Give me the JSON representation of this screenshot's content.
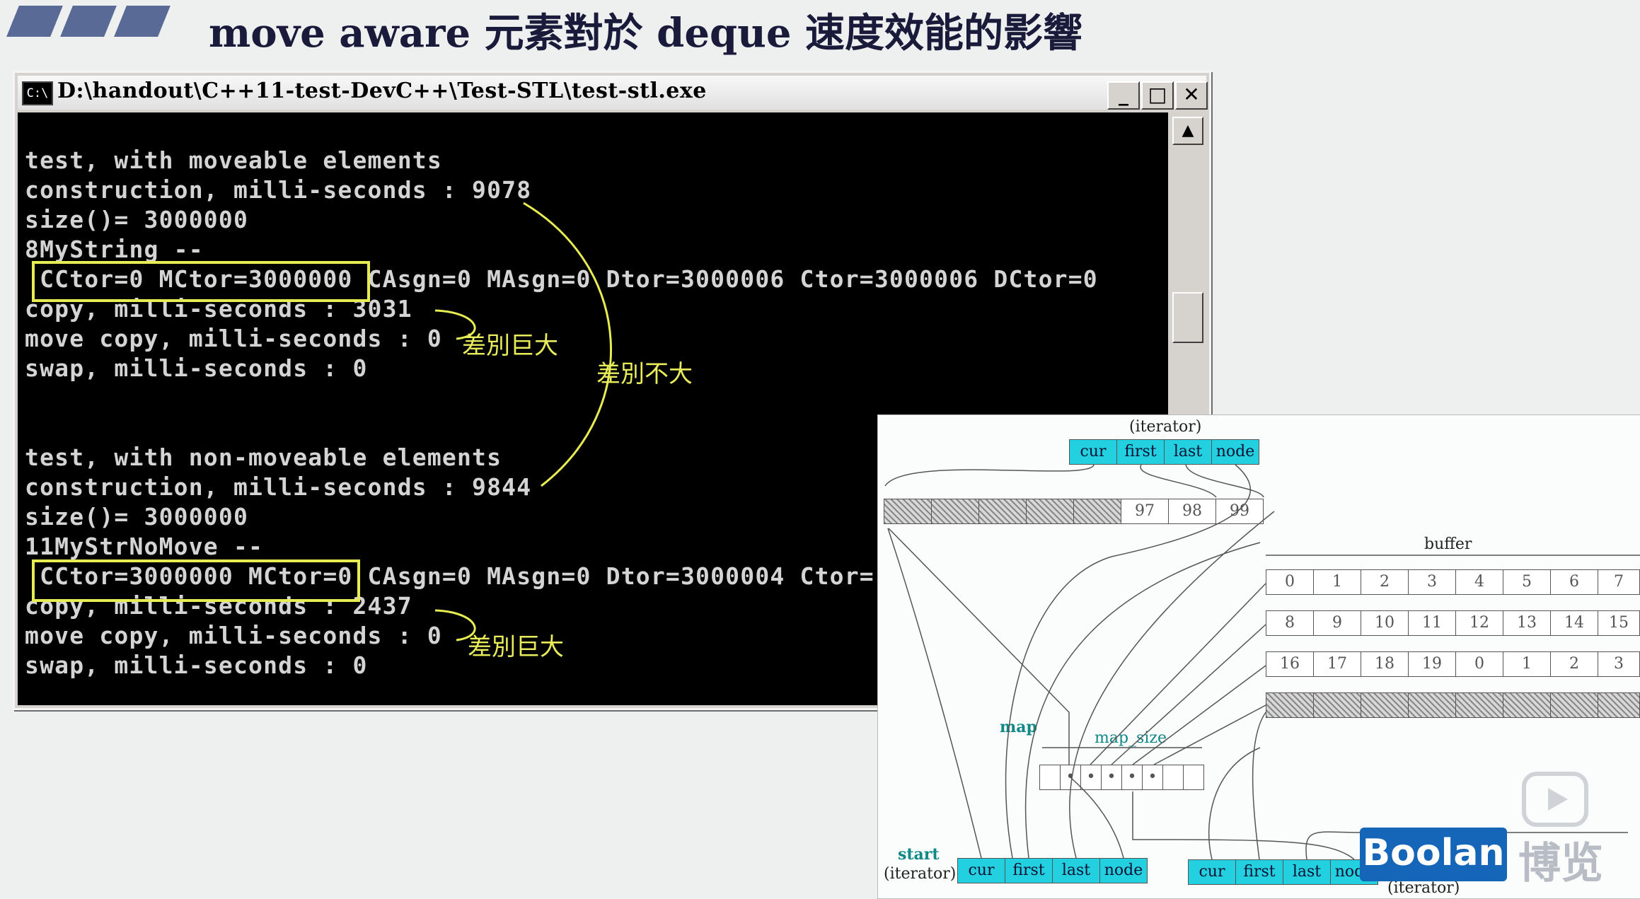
{
  "slide": {
    "title": "move aware 元素對於 deque 速度效能的影響"
  },
  "console": {
    "window_title": "D:\\handout\\C++11-test-DevC++\\Test-STL\\test-stl.exe",
    "icon_text": "C:\\",
    "minimize_label": "_",
    "maximize_label": "□",
    "close_label": "✕",
    "scroll_up_label": "▲",
    "lines": [
      "test, with moveable elements",
      "construction, milli-seconds : 9078",
      "size()= 3000000",
      "8MyString --",
      " CCtor=0 MCtor=3000000 CAsgn=0 MAsgn=0 Dtor=3000006 Ctor=3000006 DCtor=0",
      "copy, milli-seconds : 3031",
      "move copy, milli-seconds : 0",
      "swap, milli-seconds : 0",
      "",
      "",
      "test, with non-moveable elements",
      "construction, milli-seconds : 9844",
      "size()= 3000000",
      "11MyStrNoMove --",
      " CCtor=3000000 MCtor=0 CAsgn=0 MAsgn=0 Dtor=3000004 Ctor=",
      "copy, milli-seconds : 2437",
      "move copy, milli-seconds : 0",
      "swap, milli-seconds : 0"
    ]
  },
  "annotations": {
    "big_difference_1": "差別巨大",
    "small_difference": "差別不大",
    "big_difference_2": "差別巨大",
    "color": "#e6ec52"
  },
  "diagram": {
    "iterator_top_label": "(iterator)",
    "iterator_fields": [
      "cur",
      "first",
      "last",
      "node"
    ],
    "top_buffer_values": [
      "97",
      "98",
      "99"
    ],
    "buffer_label": "buffer",
    "buffer_rows": [
      [
        "0",
        "1",
        "2",
        "3",
        "4",
        "5",
        "6",
        "7"
      ],
      [
        "8",
        "9",
        "10",
        "11",
        "12",
        "13",
        "14",
        "15"
      ],
      [
        "16",
        "17",
        "18",
        "19",
        "0",
        "1",
        "2",
        "3"
      ]
    ],
    "map_label": "map",
    "map_size_label": "map_size",
    "start_label": "start",
    "start_iterator_label": "(iterator)",
    "finish_iterator_label": "(iterator)",
    "start_fields": [
      "cur",
      "first",
      "last",
      "node"
    ],
    "finish_fields": [
      "cur",
      "first",
      "last",
      "node"
    ],
    "cyan_color": "#22d0df"
  },
  "branding": {
    "logo_text": "Boolan",
    "logo_cn": "博览",
    "logo_color": "#1566b8"
  }
}
